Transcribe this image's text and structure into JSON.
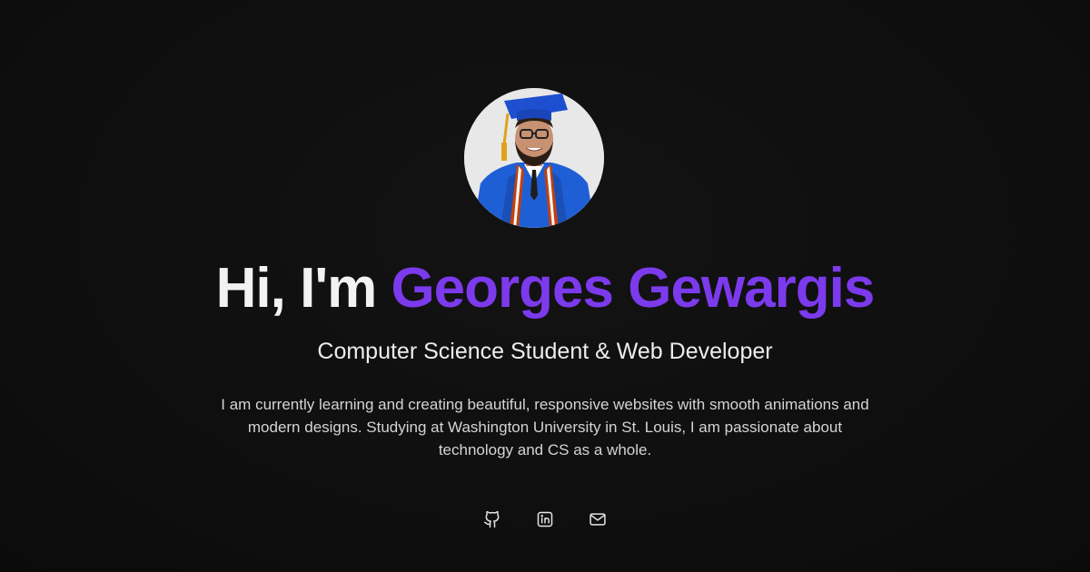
{
  "hero": {
    "greeting": "Hi, I'm",
    "name": "Georges Gewargis",
    "subtitle": "Computer Science Student & Web Developer",
    "bio": "I am currently learning and creating beautiful, responsive websites with smooth animations and modern designs. Studying at Washington University in St. Louis, I am passionate about technology and CS as a whole."
  },
  "socials": [
    {
      "icon": "github-icon"
    },
    {
      "icon": "linkedin-icon"
    },
    {
      "icon": "mail-icon"
    }
  ],
  "colors": {
    "background": "#0f0f0f",
    "accent": "#7c3aed",
    "text": "#f2f2f2"
  }
}
